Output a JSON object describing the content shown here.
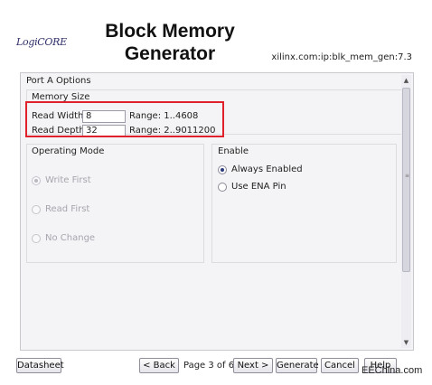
{
  "header": {
    "logo_text": "LogiCORE",
    "title_line1": "Block Memory",
    "title_line2": "Generator",
    "ip_identifier": "xilinx.com:ip:blk_mem_gen:7.3"
  },
  "panel": {
    "title": "Port A Options",
    "memory_size": {
      "title": "Memory Size",
      "read_width_label": "Read Width",
      "read_width_value": "8",
      "read_width_range": "Range: 1..4608",
      "read_depth_label": "Read Depth",
      "read_depth_value": "32",
      "read_depth_range": "Range: 2..9011200"
    },
    "operating_mode": {
      "title": "Operating Mode",
      "options": [
        "Write First",
        "Read First",
        "No Change"
      ],
      "selected": "Write First",
      "enabled": false
    },
    "enable": {
      "title": "Enable",
      "options": [
        "Always Enabled",
        "Use ENA Pin"
      ],
      "selected": "Always Enabled"
    },
    "scrollbar": {
      "up_icon": "triangle-up",
      "down_icon": "triangle-down",
      "grip_icon": "grip-lines"
    }
  },
  "footer": {
    "datasheet_label": "Datasheet",
    "back_label": "< Back",
    "page_indicator": "Page 3 of 6",
    "next_label": "Next >",
    "generate_label": "Generate",
    "cancel_label": "Cancel",
    "help_label": "Help"
  },
  "watermark": "EEChina.com",
  "colors": {
    "highlight_border": "#e0202a",
    "panel_bg": "#f4f4f6"
  }
}
